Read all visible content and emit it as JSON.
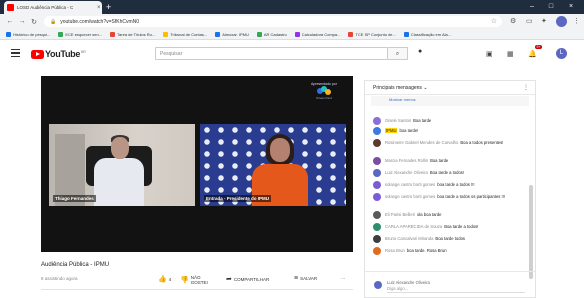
{
  "browser": {
    "tab_title": "LOSD Audiência Pública - C",
    "tab_close": "×",
    "new_tab": "+",
    "url": "youtube.com/watch?v=SfKhCvmN0",
    "controls": [
      "–",
      "□",
      "×"
    ]
  },
  "bookmarks": [
    {
      "label": "Histórico de pesqui...",
      "color": "#1a73e8"
    },
    {
      "label": "ECE esquecer sen...",
      "color": "#34a853"
    },
    {
      "label": "Tarea de Títulos Ru...",
      "color": "#ea4335"
    },
    {
      "label": "Tribunal de Contas...",
      "color": "#fbbc04"
    },
    {
      "label": "Almoxar. IPMU",
      "color": "#1a73e8"
    },
    {
      "label": "AR Cadastro",
      "color": "#34a853"
    },
    {
      "label": "Calculadora Compa...",
      "color": "#9334e6"
    },
    {
      "label": "TCE SP Conjunto de...",
      "color": "#ea4335"
    },
    {
      "label": "Classificação em Ala...",
      "color": "#1a73e8"
    }
  ],
  "youtube": {
    "logo_text": "YouTube",
    "country_code": "BR",
    "search_placeholder": "Pesquisar",
    "search_icon": "⌕",
    "mic_icon": "🎙",
    "notification_count": "9+",
    "avatar_letter": "L"
  },
  "video": {
    "title": "Audiência Pública - IPMU",
    "meta": "8 assistindo agora",
    "speaker1": "Thiago Fernandes",
    "speaker2": "Entrada - Presidente do IPMU",
    "brand_top": "Apresentado por",
    "brand_name": "StreamYard",
    "actions": {
      "like_count": "4",
      "dislike_label": "NÃO GOSTEI",
      "share_label": "COMPARTILHAR",
      "save_label": "SALVAR",
      "more_label": "…"
    }
  },
  "chat": {
    "header": "Principais mensagens",
    "header_caret": "⌄",
    "menu": "⋮",
    "pinned": "Mostrar menos",
    "messages": [
      {
        "name": "Gisele Santos",
        "text": "Boa tarde",
        "color": "#8a6fd6"
      },
      {
        "name": "IPMU",
        "text": "boa tarde!",
        "color": "#3b7be0",
        "badge": true
      },
      {
        "name": "Rosimeire Gabriel Mendes de Carvalho",
        "text": "Boa a todos presentes!",
        "color": "#5c3b2e"
      },
      {
        "name": "Marcia Fernades Rollin",
        "text": "Boa tarde",
        "color": "#7a4ea0"
      },
      {
        "name": "Luiz Alexandre Oliveira",
        "text": "Boa tarde a todos!",
        "color": "#5a68c4"
      },
      {
        "name": "solange castro borti gomes",
        "text": "boa tarde a todos !!!",
        "color": "#7b5cd6"
      },
      {
        "name": "solange castro borti gomes",
        "text": "boa tarde a todos os participantes !!!",
        "color": "#7b5cd6"
      },
      {
        "name": "Eli Parisi Bellieri",
        "text": "ola boa tarde",
        "color": "#5a5a5a"
      },
      {
        "name": "CARLA APARECIDA de Souza",
        "text": "Boa tarde a todos!",
        "color": "#2d8f6f"
      },
      {
        "name": "Bruno Cancalvari Miranda",
        "text": "Boa tarde todos",
        "color": "#3d3d3d"
      },
      {
        "name": "Rosa Brun",
        "text": "boa tarde.   Rosa Brun",
        "color": "#e06a20"
      }
    ],
    "composer_name": "Luiz Alexandre Oliveira",
    "composer_placeholder": "Diga algo..."
  }
}
